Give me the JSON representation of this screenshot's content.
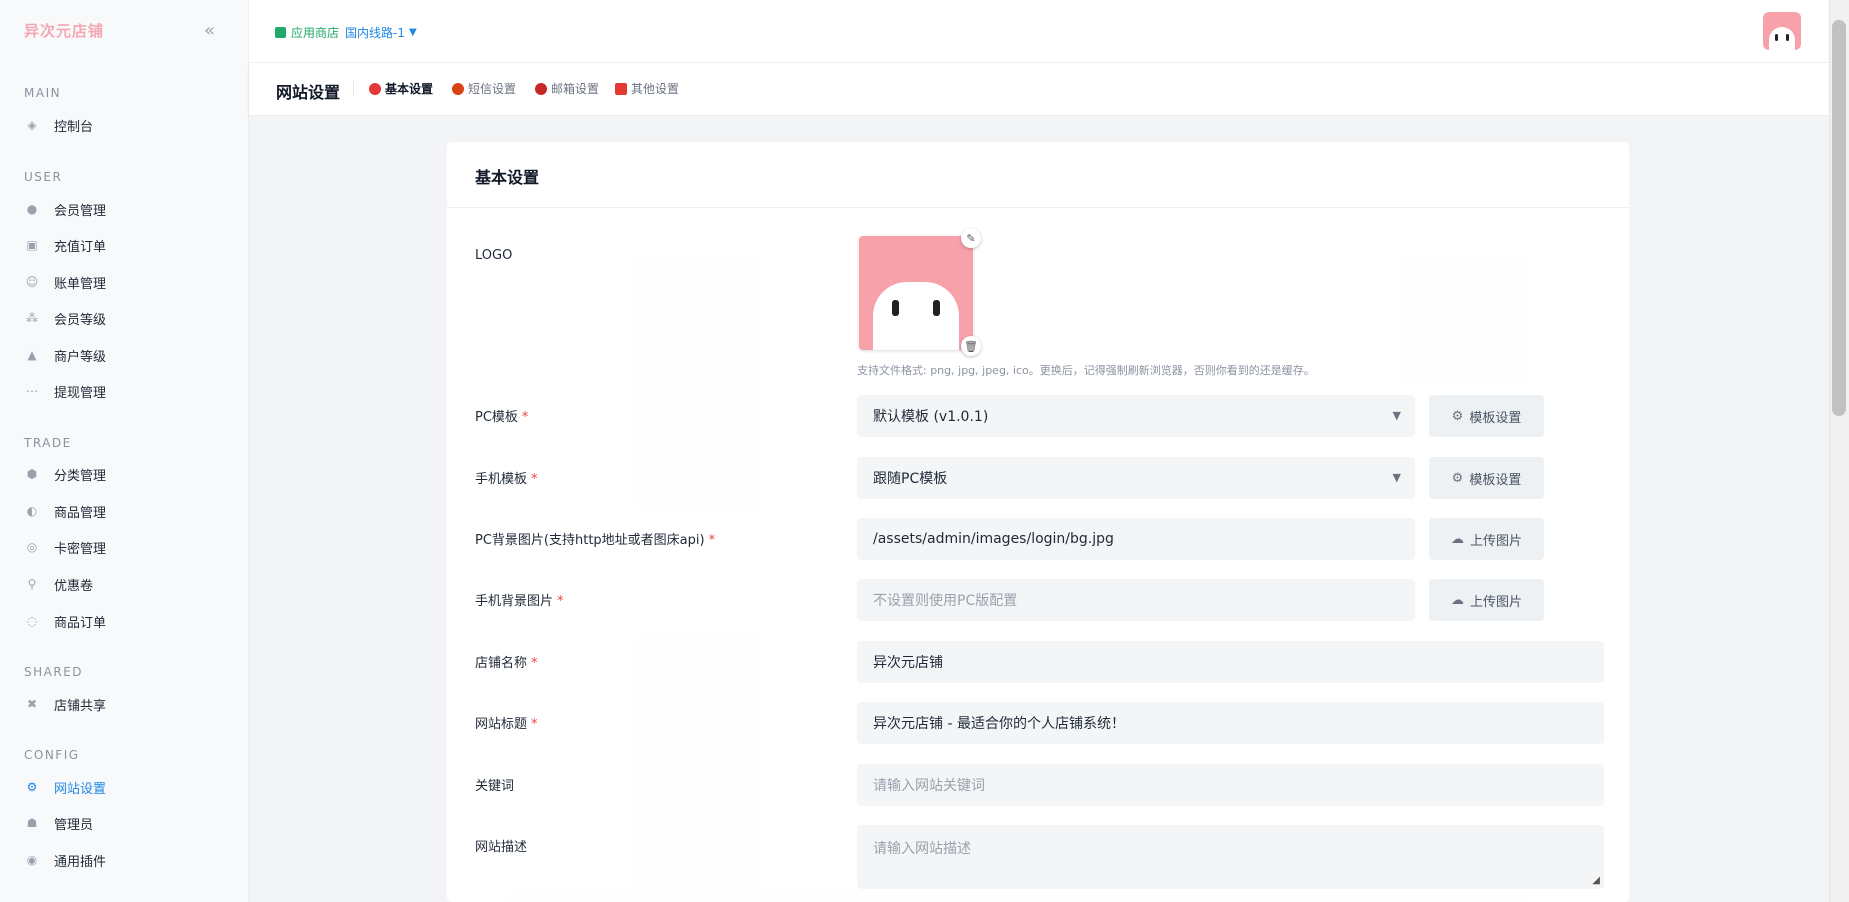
{
  "brand": "异次元店铺",
  "collapse_icon": "«",
  "sidebar": {
    "sections": [
      {
        "title": "MAIN",
        "items": [
          {
            "label": "控制台",
            "icon": "dashboard-icon"
          }
        ]
      },
      {
        "title": "USER",
        "items": [
          {
            "label": "会员管理",
            "icon": "user-icon"
          },
          {
            "label": "充值订单",
            "icon": "wallet-icon"
          },
          {
            "label": "账单管理",
            "icon": "bill-icon"
          },
          {
            "label": "会员等级",
            "icon": "level-icon"
          },
          {
            "label": "商户等级",
            "icon": "merchant-icon"
          },
          {
            "label": "提现管理",
            "icon": "withdraw-icon"
          }
        ]
      },
      {
        "title": "TRADE",
        "items": [
          {
            "label": "分类管理",
            "icon": "category-icon"
          },
          {
            "label": "商品管理",
            "icon": "product-icon"
          },
          {
            "label": "卡密管理",
            "icon": "card-icon"
          },
          {
            "label": "优惠卷",
            "icon": "coupon-icon"
          },
          {
            "label": "商品订单",
            "icon": "order-icon"
          }
        ]
      },
      {
        "title": "SHARED",
        "items": [
          {
            "label": "店铺共享",
            "icon": "share-icon"
          }
        ]
      },
      {
        "title": "CONFIG",
        "items": [
          {
            "label": "网站设置",
            "icon": "settings-icon",
            "active": true
          },
          {
            "label": "管理员",
            "icon": "admin-icon"
          },
          {
            "label": "通用插件",
            "icon": "plugin-icon"
          }
        ]
      }
    ]
  },
  "topbar": {
    "store_label": "应用商店",
    "route_label": "国内线路-1"
  },
  "subbar": {
    "title": "网站设置",
    "tabs": [
      {
        "label": "基本设置",
        "active": true,
        "color": "#e53935"
      },
      {
        "label": "短信设置",
        "active": false,
        "color": "#d84315"
      },
      {
        "label": "邮箱设置",
        "active": false,
        "color": "#c62828"
      },
      {
        "label": "其他设置",
        "active": false,
        "color": "#e53935"
      }
    ]
  },
  "card": {
    "title": "基本设置",
    "logo_label": "LOGO",
    "logo_hint": "支持文件格式: png, jpg, jpeg, ico。更换后，记得强制刷新浏览器，否则你看到的还是缓存。",
    "fields": {
      "pc_template": {
        "label": "PC模板",
        "value": "默认模板 (v1.0.1)",
        "button": "模板设置"
      },
      "mobile_template": {
        "label": "手机模板",
        "value": "跟随PC模板",
        "button": "模板设置"
      },
      "pc_bg": {
        "label": "PC背景图片(支持http地址或者图床api)",
        "value": "/assets/admin/images/login/bg.jpg",
        "button": "上传图片"
      },
      "mobile_bg": {
        "label": "手机背景图片",
        "placeholder": "不设置则使用PC版配置",
        "button": "上传图片"
      },
      "shop_name": {
        "label": "店铺名称",
        "value": "异次元店铺"
      },
      "site_title": {
        "label": "网站标题",
        "value": "异次元店铺 - 最适合你的个人店铺系统！"
      },
      "keywords": {
        "label": "关键词",
        "placeholder": "请输入网站关键词"
      },
      "description": {
        "label": "网站描述",
        "placeholder": "请输入网站描述"
      }
    }
  },
  "colors": {
    "accent": "#1e88e5",
    "brand_pink": "#f7a1ab",
    "required": "#ef4444",
    "store_green": "#22a86b"
  }
}
